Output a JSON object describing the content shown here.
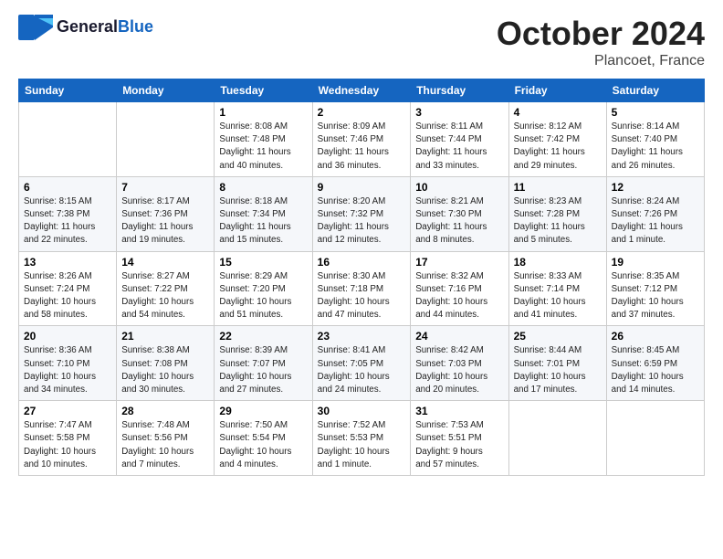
{
  "header": {
    "logo_line1": "General",
    "logo_line2": "Blue",
    "month": "October 2024",
    "location": "Plancoet, France"
  },
  "days_of_week": [
    "Sunday",
    "Monday",
    "Tuesday",
    "Wednesday",
    "Thursday",
    "Friday",
    "Saturday"
  ],
  "weeks": [
    [
      {
        "day": "",
        "info": ""
      },
      {
        "day": "",
        "info": ""
      },
      {
        "day": "1",
        "info": "Sunrise: 8:08 AM\nSunset: 7:48 PM\nDaylight: 11 hours\nand 40 minutes."
      },
      {
        "day": "2",
        "info": "Sunrise: 8:09 AM\nSunset: 7:46 PM\nDaylight: 11 hours\nand 36 minutes."
      },
      {
        "day": "3",
        "info": "Sunrise: 8:11 AM\nSunset: 7:44 PM\nDaylight: 11 hours\nand 33 minutes."
      },
      {
        "day": "4",
        "info": "Sunrise: 8:12 AM\nSunset: 7:42 PM\nDaylight: 11 hours\nand 29 minutes."
      },
      {
        "day": "5",
        "info": "Sunrise: 8:14 AM\nSunset: 7:40 PM\nDaylight: 11 hours\nand 26 minutes."
      }
    ],
    [
      {
        "day": "6",
        "info": "Sunrise: 8:15 AM\nSunset: 7:38 PM\nDaylight: 11 hours\nand 22 minutes."
      },
      {
        "day": "7",
        "info": "Sunrise: 8:17 AM\nSunset: 7:36 PM\nDaylight: 11 hours\nand 19 minutes."
      },
      {
        "day": "8",
        "info": "Sunrise: 8:18 AM\nSunset: 7:34 PM\nDaylight: 11 hours\nand 15 minutes."
      },
      {
        "day": "9",
        "info": "Sunrise: 8:20 AM\nSunset: 7:32 PM\nDaylight: 11 hours\nand 12 minutes."
      },
      {
        "day": "10",
        "info": "Sunrise: 8:21 AM\nSunset: 7:30 PM\nDaylight: 11 hours\nand 8 minutes."
      },
      {
        "day": "11",
        "info": "Sunrise: 8:23 AM\nSunset: 7:28 PM\nDaylight: 11 hours\nand 5 minutes."
      },
      {
        "day": "12",
        "info": "Sunrise: 8:24 AM\nSunset: 7:26 PM\nDaylight: 11 hours\nand 1 minute."
      }
    ],
    [
      {
        "day": "13",
        "info": "Sunrise: 8:26 AM\nSunset: 7:24 PM\nDaylight: 10 hours\nand 58 minutes."
      },
      {
        "day": "14",
        "info": "Sunrise: 8:27 AM\nSunset: 7:22 PM\nDaylight: 10 hours\nand 54 minutes."
      },
      {
        "day": "15",
        "info": "Sunrise: 8:29 AM\nSunset: 7:20 PM\nDaylight: 10 hours\nand 51 minutes."
      },
      {
        "day": "16",
        "info": "Sunrise: 8:30 AM\nSunset: 7:18 PM\nDaylight: 10 hours\nand 47 minutes."
      },
      {
        "day": "17",
        "info": "Sunrise: 8:32 AM\nSunset: 7:16 PM\nDaylight: 10 hours\nand 44 minutes."
      },
      {
        "day": "18",
        "info": "Sunrise: 8:33 AM\nSunset: 7:14 PM\nDaylight: 10 hours\nand 41 minutes."
      },
      {
        "day": "19",
        "info": "Sunrise: 8:35 AM\nSunset: 7:12 PM\nDaylight: 10 hours\nand 37 minutes."
      }
    ],
    [
      {
        "day": "20",
        "info": "Sunrise: 8:36 AM\nSunset: 7:10 PM\nDaylight: 10 hours\nand 34 minutes."
      },
      {
        "day": "21",
        "info": "Sunrise: 8:38 AM\nSunset: 7:08 PM\nDaylight: 10 hours\nand 30 minutes."
      },
      {
        "day": "22",
        "info": "Sunrise: 8:39 AM\nSunset: 7:07 PM\nDaylight: 10 hours\nand 27 minutes."
      },
      {
        "day": "23",
        "info": "Sunrise: 8:41 AM\nSunset: 7:05 PM\nDaylight: 10 hours\nand 24 minutes."
      },
      {
        "day": "24",
        "info": "Sunrise: 8:42 AM\nSunset: 7:03 PM\nDaylight: 10 hours\nand 20 minutes."
      },
      {
        "day": "25",
        "info": "Sunrise: 8:44 AM\nSunset: 7:01 PM\nDaylight: 10 hours\nand 17 minutes."
      },
      {
        "day": "26",
        "info": "Sunrise: 8:45 AM\nSunset: 6:59 PM\nDaylight: 10 hours\nand 14 minutes."
      }
    ],
    [
      {
        "day": "27",
        "info": "Sunrise: 7:47 AM\nSunset: 5:58 PM\nDaylight: 10 hours\nand 10 minutes."
      },
      {
        "day": "28",
        "info": "Sunrise: 7:48 AM\nSunset: 5:56 PM\nDaylight: 10 hours\nand 7 minutes."
      },
      {
        "day": "29",
        "info": "Sunrise: 7:50 AM\nSunset: 5:54 PM\nDaylight: 10 hours\nand 4 minutes."
      },
      {
        "day": "30",
        "info": "Sunrise: 7:52 AM\nSunset: 5:53 PM\nDaylight: 10 hours\nand 1 minute."
      },
      {
        "day": "31",
        "info": "Sunrise: 7:53 AM\nSunset: 5:51 PM\nDaylight: 9 hours\nand 57 minutes."
      },
      {
        "day": "",
        "info": ""
      },
      {
        "day": "",
        "info": ""
      }
    ]
  ]
}
